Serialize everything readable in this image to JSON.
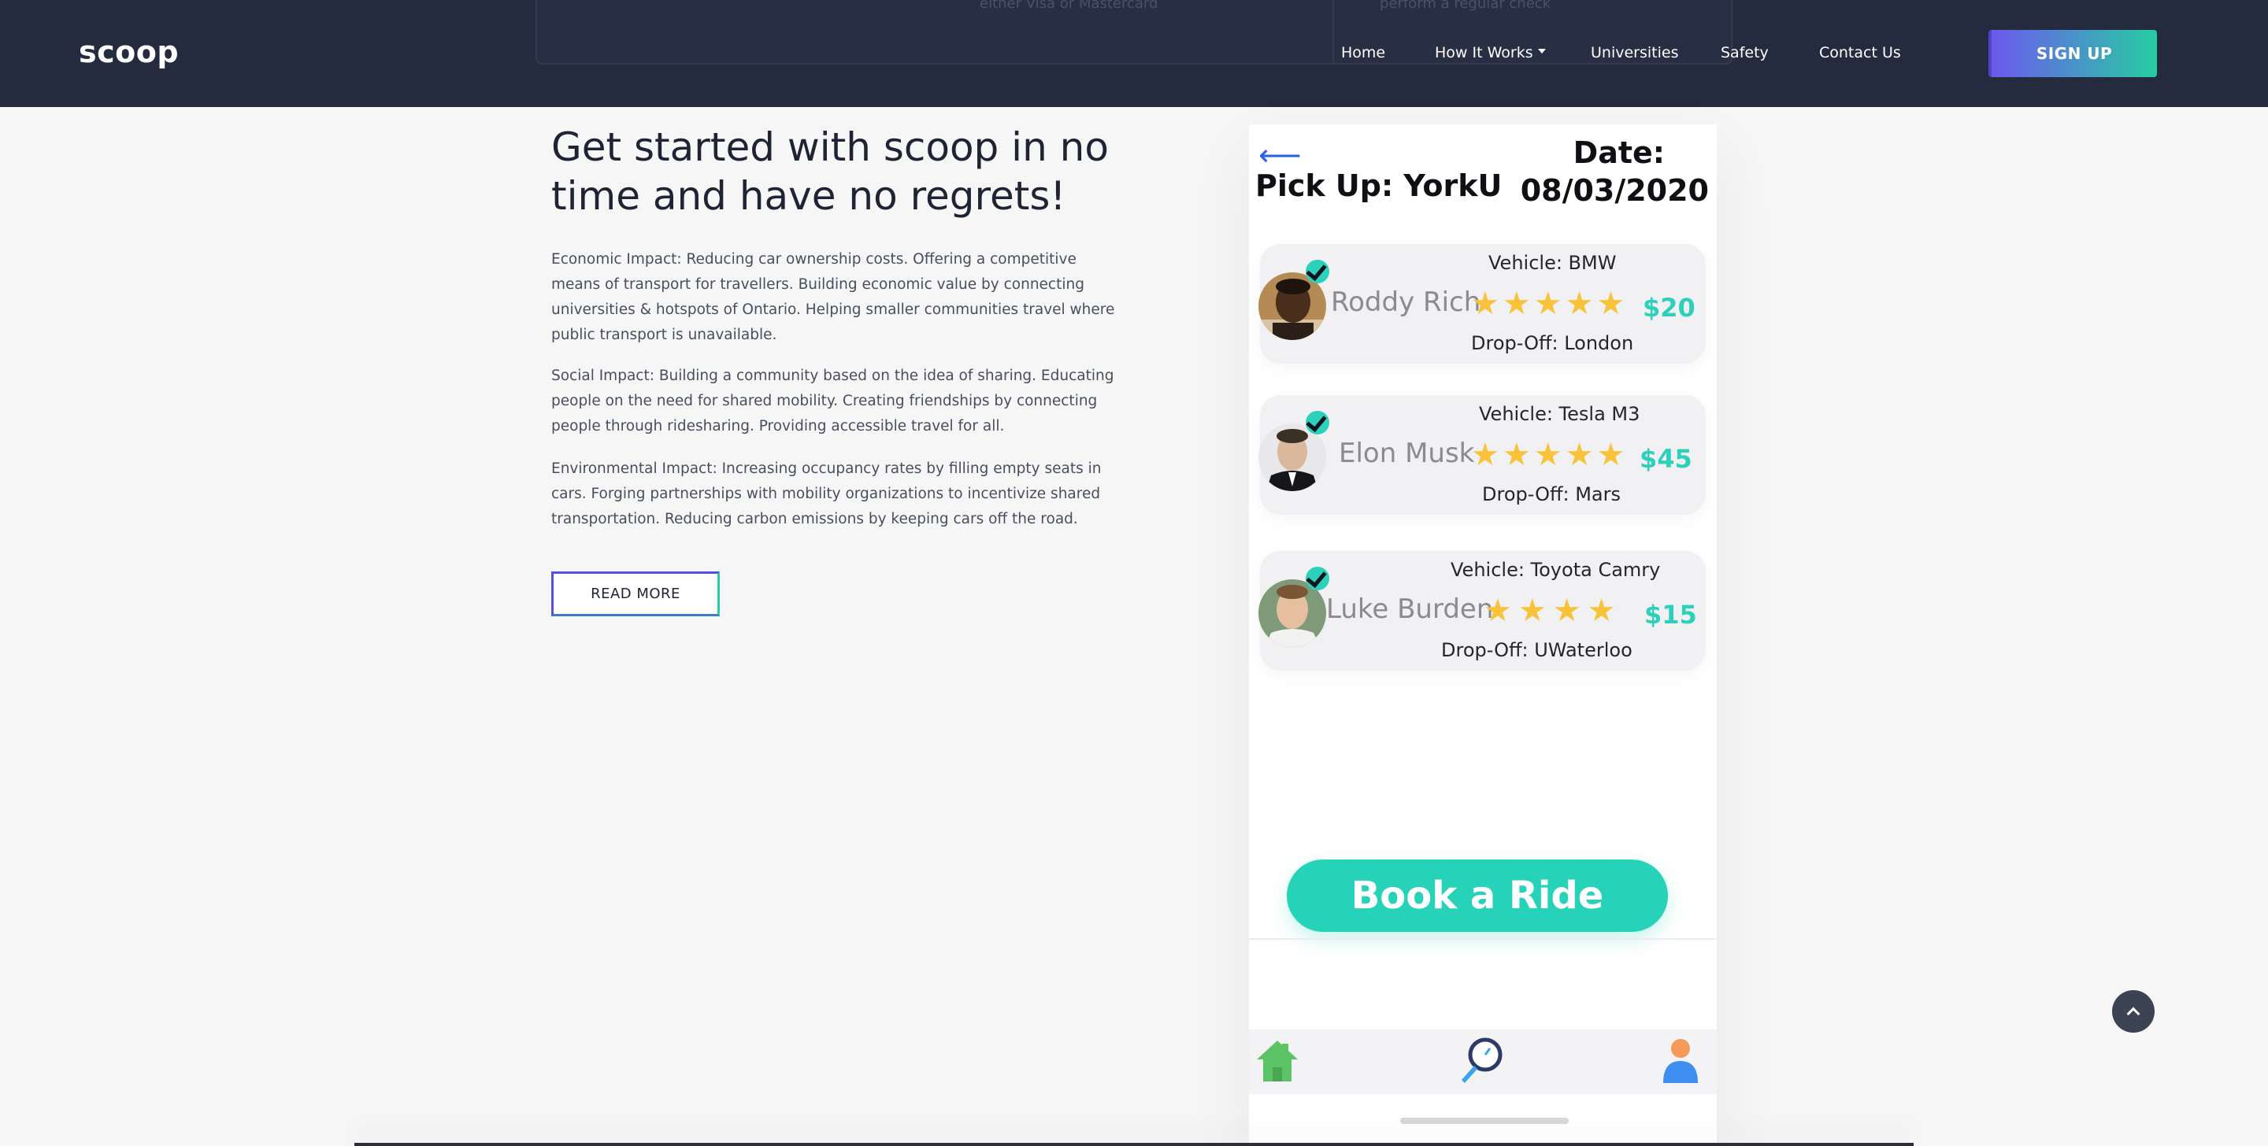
{
  "header": {
    "logo": "scoop",
    "ghost_text_left": "either Visa or Mastercard",
    "ghost_text_right": "perform a regular check",
    "nav": [
      {
        "label": "Home"
      },
      {
        "label": "How It Works"
      },
      {
        "label": "Universities"
      },
      {
        "label": "Safety"
      },
      {
        "label": "Contact Us"
      }
    ],
    "signup_label": "SIGN UP"
  },
  "main": {
    "headline": "Get started with scoop in no time and have no regrets!",
    "paragraphs": [
      "Economic Impact: Reducing car ownership costs. Offering a competitive means of transport for travellers. Building economic value by connecting universities & hotspots of Ontario. Helping smaller communities travel where public transport is unavailable.",
      "Social Impact: Building a community based on the idea of sharing. Educating people on the need for shared mobility. Creating friendships by connecting people through ridesharing. Providing accessible travel for all.",
      "Environmental Impact: Increasing occupancy rates by filling empty seats in cars. Forging partnerships with mobility organizations to incentivize shared transportation. Reducing carbon emissions by keeping cars off the road."
    ],
    "read_more_label": "READ MORE"
  },
  "phone": {
    "back_arrow": "⟵",
    "pickup": "Pick Up: YorkU",
    "date_label": "Date:",
    "date_value": "08/03/2020",
    "rides": [
      {
        "driver": "Roddy Rich",
        "vehicle": "Vehicle: BMW",
        "dropoff": "Drop-Off: London",
        "price": "$20",
        "rating": 5
      },
      {
        "driver": "Elon Musk",
        "vehicle": "Vehicle: Tesla M3",
        "dropoff": "Drop-Off: Mars",
        "price": "$45",
        "rating": 5
      },
      {
        "driver": "Luke Burden",
        "vehicle": "Vehicle: Toyota Camry",
        "dropoff": "Drop-Off: UWaterloo",
        "price": "$15",
        "rating": 4
      }
    ],
    "book_label": "Book a Ride",
    "tabs": [
      {
        "icon": "home-icon"
      },
      {
        "icon": "search-icon"
      },
      {
        "icon": "profile-icon"
      }
    ]
  },
  "colors": {
    "header_bg": "#252b3f",
    "accent_teal": "#26d3b8",
    "accent_purple": "#6c58ee",
    "star": "#f8c338"
  }
}
